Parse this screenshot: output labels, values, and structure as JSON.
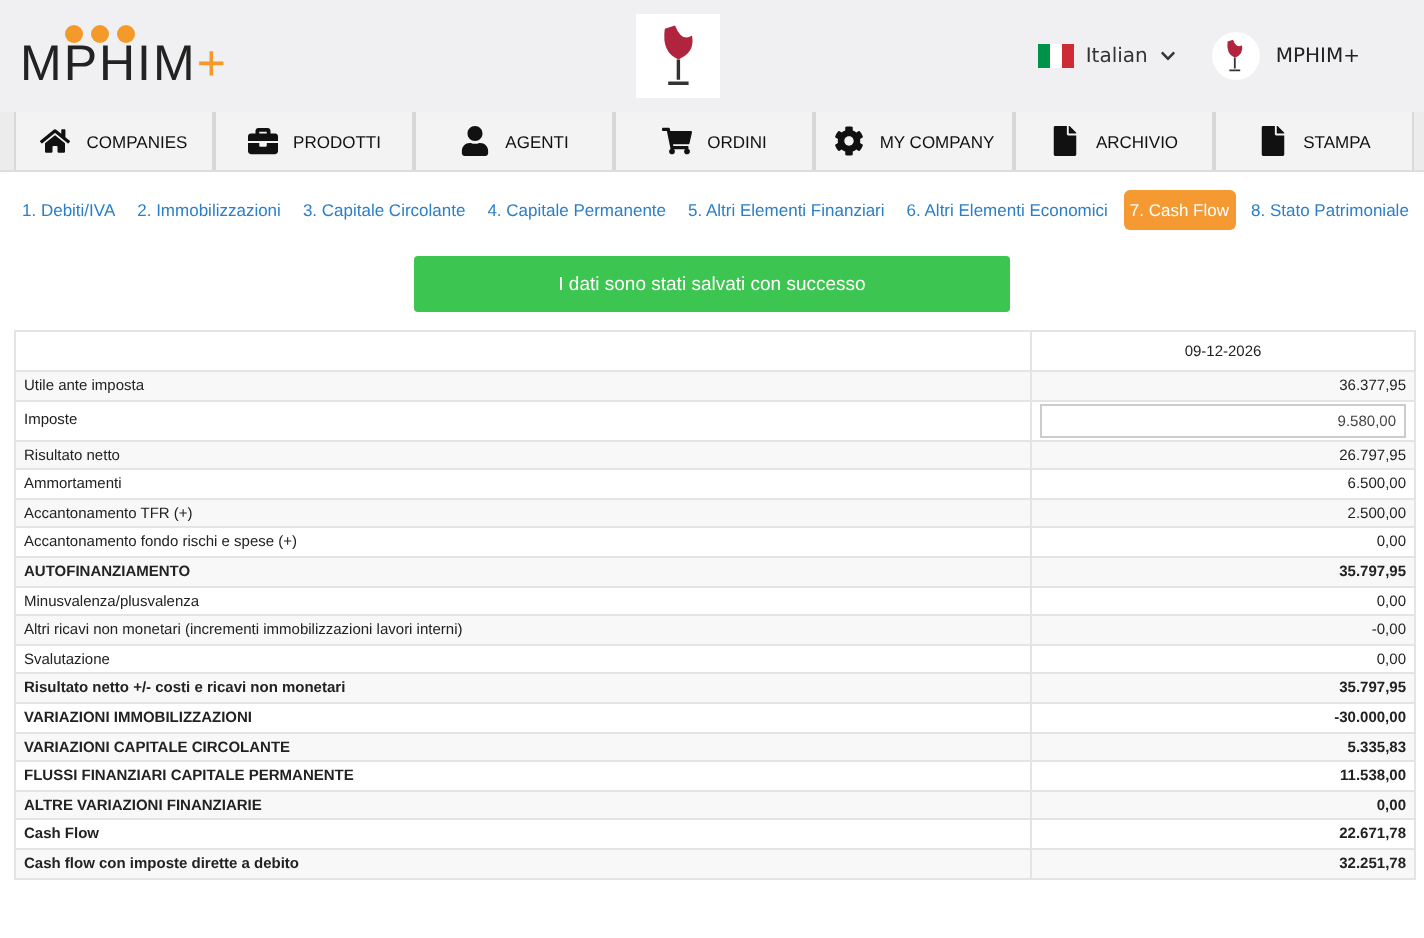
{
  "header": {
    "logo": {
      "text": "MPHIM",
      "mark": "+"
    },
    "language": {
      "label": "Italian"
    },
    "user": {
      "name": "MPHIM+"
    }
  },
  "nav": [
    {
      "label": "COMPANIES",
      "kind": "home"
    },
    {
      "label": "PRODOTTI",
      "kind": "briefcase"
    },
    {
      "label": "AGENTI",
      "kind": "user"
    },
    {
      "label": "ORDINI",
      "kind": "cart"
    },
    {
      "label": "MY COMPANY",
      "kind": "gear"
    },
    {
      "label": "ARCHIVIO",
      "kind": "file"
    },
    {
      "label": "STAMPA",
      "kind": "file"
    }
  ],
  "steps": [
    {
      "label": "1. Debiti/IVA",
      "selected": false
    },
    {
      "label": "2. Immobilizzazioni",
      "selected": false
    },
    {
      "label": "3. Capitale Circolante",
      "selected": false
    },
    {
      "label": "4. Capitale Permanente",
      "selected": false
    },
    {
      "label": "5. Altri Elementi Finanziari",
      "selected": false
    },
    {
      "label": "6. Altri Elementi Economici",
      "selected": false
    },
    {
      "label": "7. Cash Flow",
      "selected": true
    },
    {
      "label": "8. Stato Patrimoniale",
      "selected": false
    }
  ],
  "alert": {
    "message": "I dati sono stati salvati con successo"
  },
  "table": {
    "columns": [
      "09-12-2026"
    ],
    "rows": [
      {
        "label": "Utile ante imposta",
        "value": "36.377,95",
        "kind": "text",
        "bold": false
      },
      {
        "label": "Imposte",
        "value": "9.580,00",
        "kind": "input",
        "bold": false
      },
      {
        "label": "Risultato netto",
        "value": "26.797,95",
        "kind": "text",
        "bold": false
      },
      {
        "label": "Ammortamenti",
        "value": "6.500,00",
        "kind": "text",
        "bold": false
      },
      {
        "label": "Accantonamento TFR (+)",
        "value": "2.500,00",
        "kind": "text",
        "bold": false
      },
      {
        "label": "Accantonamento fondo rischi e spese (+)",
        "value": "0,00",
        "kind": "text",
        "bold": false
      },
      {
        "label": "AUTOFINANZIAMENTO",
        "value": "35.797,95",
        "kind": "text",
        "bold": true
      },
      {
        "label": "Minusvalenza/plusvalenza",
        "value": "0,00",
        "kind": "text",
        "bold": false
      },
      {
        "label": "Altri ricavi non monetari (incrementi immobilizzazioni lavori interni)",
        "value": "-0,00",
        "kind": "text",
        "bold": false
      },
      {
        "label": "Svalutazione",
        "value": "0,00",
        "kind": "text",
        "bold": false
      },
      {
        "label": "Risultato netto +/- costi e ricavi non monetari",
        "value": "35.797,95",
        "kind": "text",
        "bold": true
      },
      {
        "label": "VARIAZIONI IMMOBILIZZAZIONI",
        "value": "-30.000,00",
        "kind": "text",
        "bold": true
      },
      {
        "label": "VARIAZIONI CAPITALE CIRCOLANTE",
        "value": "5.335,83",
        "kind": "text",
        "bold": true
      },
      {
        "label": "FLUSSI FINANZIARI CAPITALE PERMANENTE",
        "value": "11.538,00",
        "kind": "text",
        "bold": true
      },
      {
        "label": "ALTRE VARIAZIONI FINANZIARIE",
        "value": "0,00",
        "kind": "text",
        "bold": true
      },
      {
        "label": "Cash Flow",
        "value": "22.671,78",
        "kind": "text",
        "bold": true
      },
      {
        "label": "Cash flow con imposte dirette a debito",
        "value": "32.251,78",
        "kind": "text",
        "bold": true
      }
    ]
  }
}
